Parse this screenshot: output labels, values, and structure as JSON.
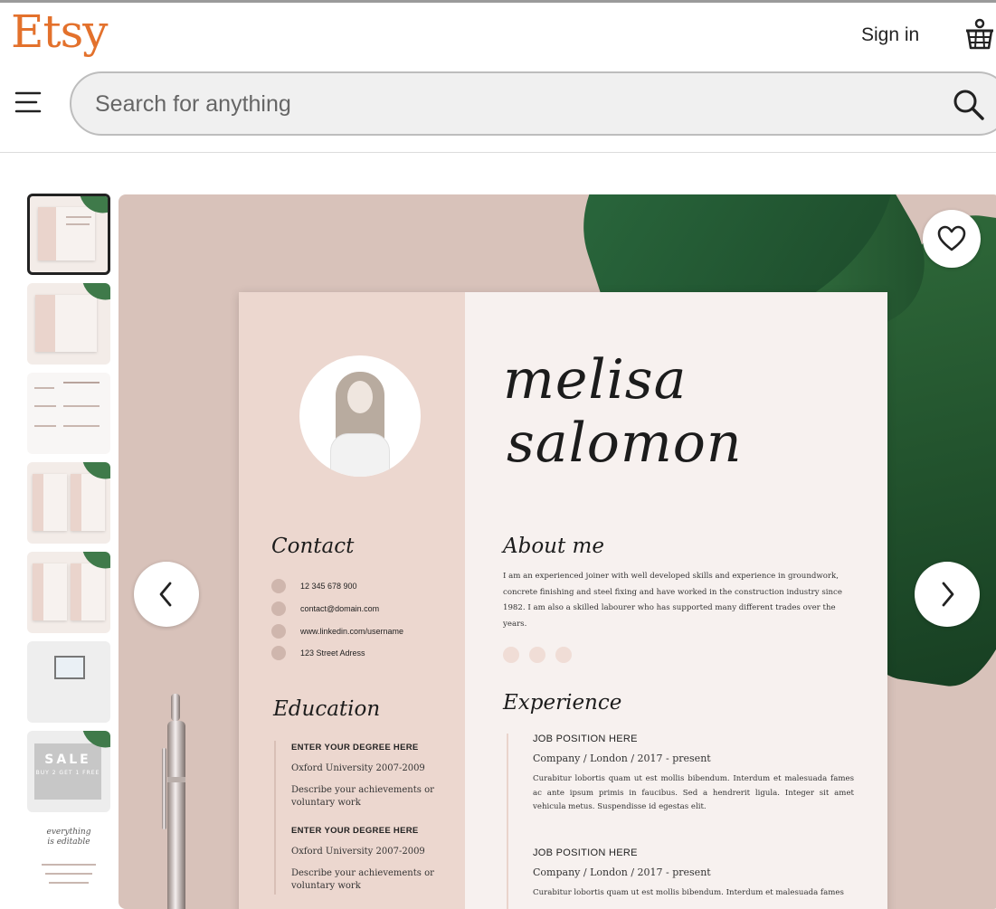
{
  "header": {
    "logo": "Etsy",
    "sign_in": "Sign in",
    "cart_icon": "basket-icon",
    "menu_icon": "hamburger-icon"
  },
  "search": {
    "placeholder": "Search for anything",
    "icon": "search-icon"
  },
  "gallery": {
    "thumbnail_count": 8,
    "active_index": 0,
    "thumb_sale": {
      "title": "SALE",
      "subtitle": "BUY 2 GET 1 FREE"
    },
    "thumb_editable": {
      "line1": "everything",
      "line2": "is editable"
    },
    "favorite_icon": "heart-icon",
    "prev_icon": "chevron-left-icon",
    "next_icon": "chevron-right-icon"
  },
  "resume": {
    "first_name": "melisa",
    "last_name": "salomon",
    "contact_heading": "Contact",
    "contact": [
      {
        "icon": "phone-icon",
        "text": "12 345 678 900"
      },
      {
        "icon": "email-icon",
        "text": "contact@domain.com"
      },
      {
        "icon": "linkedin-icon",
        "text": "www.linkedin.com/username"
      },
      {
        "icon": "location-icon",
        "text": "123 Street Adress"
      }
    ],
    "about_heading": "About me",
    "about_text": "I am an experienced joiner with well developed skills and experience in groundwork, concrete finishing and steel fixing and have worked in the construction industry since 1982. I am also a skilled labourer who has supported many different trades over the years.",
    "social_icons": [
      "twitter-icon",
      "instagram-icon",
      "pinterest-icon"
    ],
    "education_heading": "Education",
    "education": [
      {
        "degree": "ENTER YOUR DEGREE HERE",
        "university": "Oxford University 2007-2009",
        "description": "Describe your achievements or voluntary work"
      },
      {
        "degree": "ENTER YOUR DEGREE HERE",
        "university": "Oxford University 2007-2009",
        "description": "Describe your achievements or voluntary work"
      }
    ],
    "experience_heading": "Experience",
    "experience": [
      {
        "position": "JOB POSITION HERE",
        "company": "Company / London / 2017 - present",
        "description": "Curabitur lobortis quam ut est mollis bibendum. Interdum et malesuada fames ac ante ipsum primis in faucibus. Sed a hendrerit ligula. Integer sit amet vehicula metus. Suspendisse id egestas elit."
      },
      {
        "position": "JOB POSITION HERE",
        "company": "Company / London / 2017 - present",
        "description": "Curabitur lobortis quam ut est mollis bibendum. Interdum et malesuada fames"
      }
    ]
  },
  "colors": {
    "brand": "#e3712c",
    "resume_side": "#ecd7cf",
    "background": "#d8c2ba"
  }
}
